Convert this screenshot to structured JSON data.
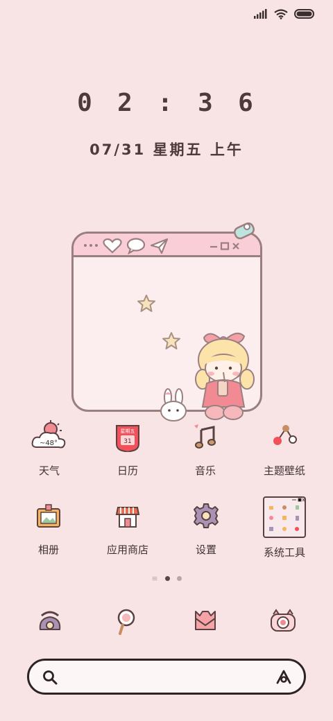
{
  "status_bar": {
    "signal_icon": "signal-bars-icon",
    "wifi_icon": "wifi-icon",
    "battery_icon": "battery-icon"
  },
  "clock": {
    "h1": "0",
    "h2": "2",
    "sep": ":",
    "m1": "3",
    "m2": "6"
  },
  "date": {
    "text": "07/31 星期五 上午"
  },
  "widget": {
    "bar_icons": [
      "heart-icon",
      "chat-bubble-icon",
      "paper-plane-icon"
    ],
    "window_controls": [
      "minimize-icon",
      "maximize-icon",
      "close-icon"
    ]
  },
  "apps_row1": [
    {
      "label": "天气",
      "icon": "weather-icon",
      "badge": "~48°"
    },
    {
      "label": "日历",
      "icon": "calendar-icon",
      "badge_top": "星期五",
      "badge_num": "31"
    },
    {
      "label": "音乐",
      "icon": "music-note-icon"
    },
    {
      "label": "主题壁纸",
      "icon": "theme-wallpaper-icon"
    }
  ],
  "apps_row2": [
    {
      "label": "相册",
      "icon": "photo-album-icon"
    },
    {
      "label": "应用商店",
      "icon": "app-store-icon"
    },
    {
      "label": "设置",
      "icon": "settings-gear-icon"
    },
    {
      "label": "系统工具",
      "icon": "system-tools-folder-icon"
    }
  ],
  "page_indicator": {
    "lines": "≡",
    "total_dots": 2,
    "active_index": 0
  },
  "dock": [
    "phone-icon",
    "browser-magnifier-icon",
    "messages-envelope-icon",
    "camera-icon"
  ],
  "search": {
    "placeholder": "",
    "value": ""
  },
  "colors": {
    "background": "#f8e3e5",
    "outline": "#9a7f80",
    "accent_pink": "#f9ced6",
    "text": "#4a3636"
  }
}
